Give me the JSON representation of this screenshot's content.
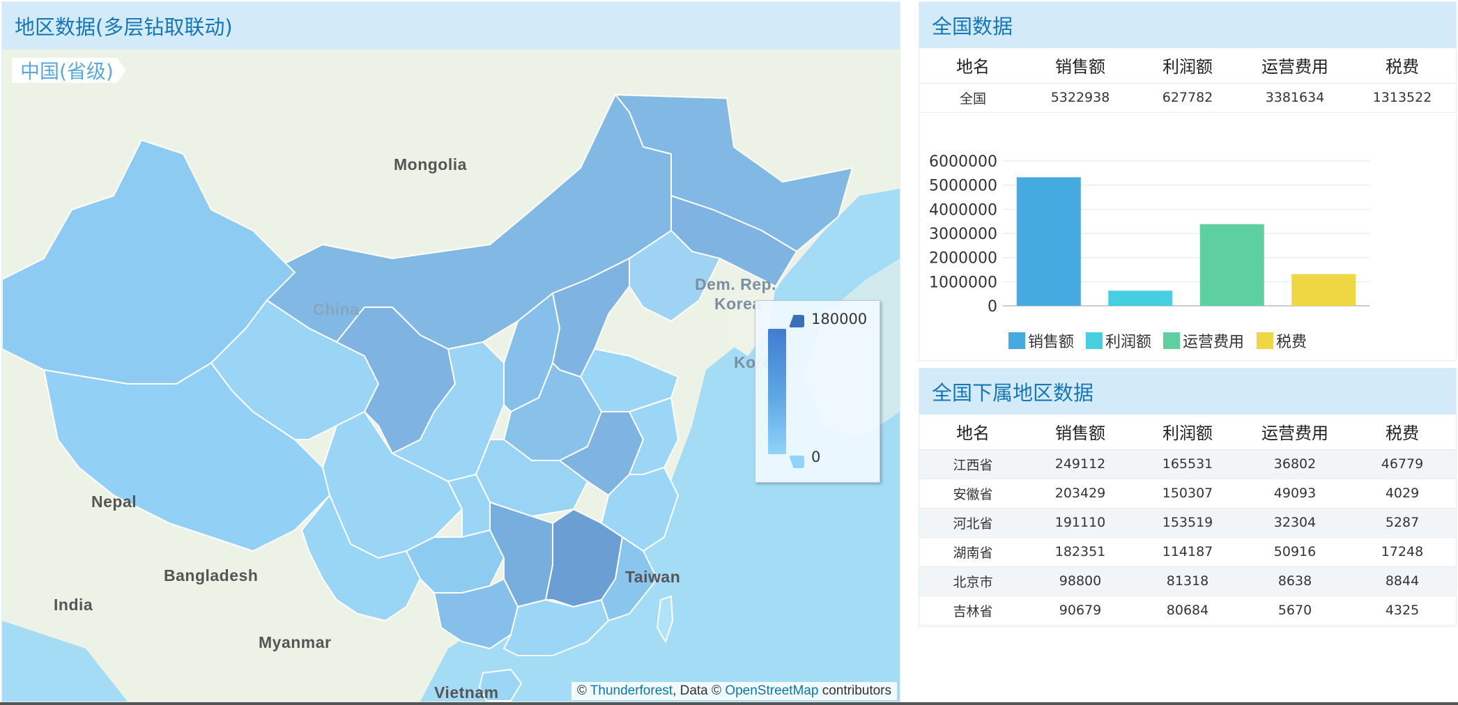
{
  "map_panel": {
    "title": "地区数据(多层钻取联动)",
    "level_tag": "中国(省级)",
    "labels": {
      "mongolia": "Mongolia",
      "china": "China",
      "dprk": "Dem. Rep.",
      "korea_line2": "Korea",
      "korea": "Kore",
      "nepal": "Nepal",
      "bangladesh": "Bangladesh",
      "india": "India",
      "myanmar": "Myanmar",
      "taiwan": "Taiwan",
      "vietnam": "Vietnam"
    },
    "attribution": {
      "prefix": "© ",
      "link1": "Thunderforest",
      "middle": ", Data © ",
      "link2": "OpenStreetMap",
      "suffix": " contributors"
    },
    "visual_map": {
      "max": "180000",
      "min": "0"
    }
  },
  "national_panel": {
    "title": "全国数据",
    "columns": [
      "地名",
      "销售额",
      "利润额",
      "运营费用",
      "税费"
    ],
    "row": [
      "全国",
      "5322938",
      "627782",
      "3381634",
      "1313522"
    ]
  },
  "chart_data": {
    "type": "bar",
    "categories": [
      "销售额",
      "利润额",
      "运营费用",
      "税费"
    ],
    "values": [
      5322938,
      627782,
      3381634,
      1313522
    ],
    "colors": [
      "#45aae0",
      "#46cfe0",
      "#5ecf9f",
      "#eed742"
    ],
    "y_ticks": [
      "6000000",
      "5000000",
      "4000000",
      "3000000",
      "2000000",
      "1000000",
      "0"
    ],
    "ylim": [
      0,
      6000000
    ],
    "grid": true,
    "legend": "bottom",
    "legend_items": [
      "销售额",
      "利润额",
      "运营费用",
      "税费"
    ]
  },
  "region_panel": {
    "title": "全国下属地区数据",
    "columns": [
      "地名",
      "销售额",
      "利润额",
      "运营费用",
      "税费"
    ],
    "rows": [
      [
        "江西省",
        "249112",
        "165531",
        "36802",
        "46779"
      ],
      [
        "安徽省",
        "203429",
        "150307",
        "49093",
        "4029"
      ],
      [
        "河北省",
        "191110",
        "153519",
        "32304",
        "5287"
      ],
      [
        "湖南省",
        "182351",
        "114187",
        "50916",
        "17248"
      ],
      [
        "北京市",
        "98800",
        "81318",
        "8638",
        "8844"
      ],
      [
        "吉林省",
        "90679",
        "80684",
        "5670",
        "4325"
      ]
    ]
  }
}
